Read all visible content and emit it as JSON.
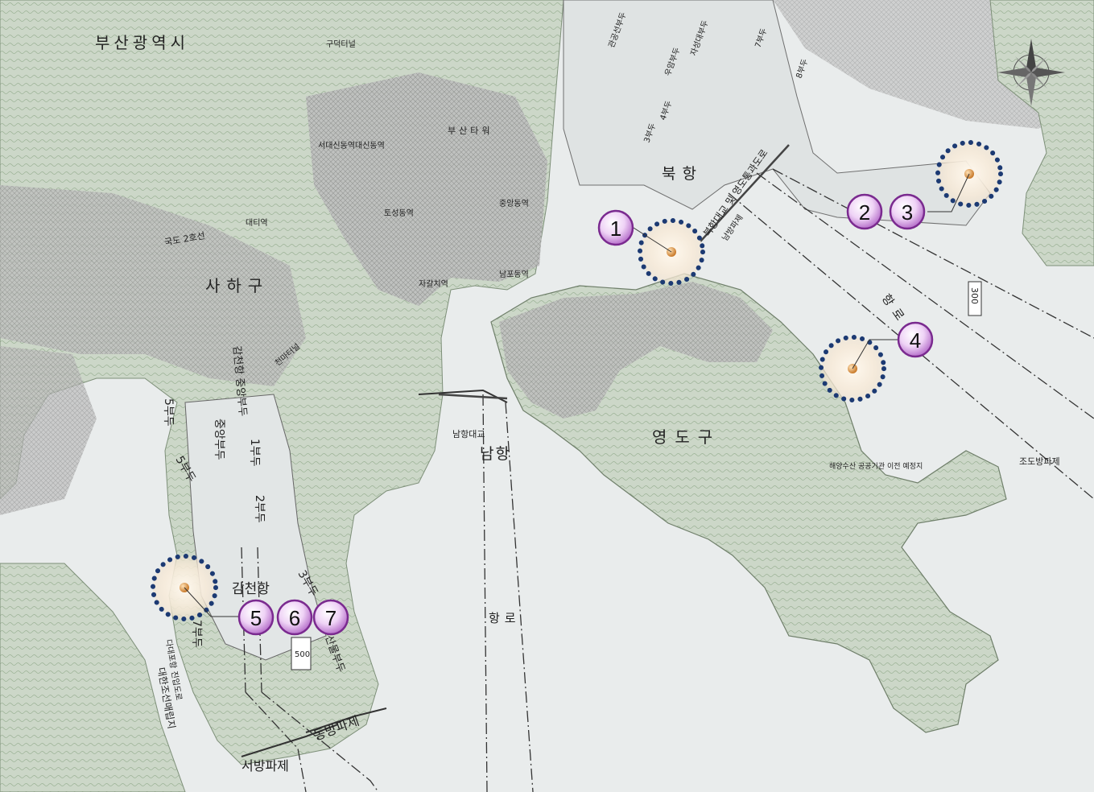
{
  "colors": {
    "sea": "#e9ecec",
    "land": "#c9d4c6",
    "land_dark": "#9fb19a",
    "city": "#a9a9a9",
    "marker_ring": "#1c3a73",
    "badge_fill": "#c98ad8",
    "badge_stroke": "#7a2a8f"
  },
  "labels": {
    "busan_city": "부산광역시",
    "saha_gu": "사하구",
    "yeongdo_gu": "영도구",
    "bukhang": "북항",
    "namhang": "남항",
    "gamcheon_port": "감천항",
    "north_route": "항로",
    "south_route": "항로",
    "namhang_bridge": "남항대교",
    "bukhang_bridge": "북항대교 및 영도통과도로",
    "namhang_breakwater": "남방파제",
    "west_breakwater": "서방파제",
    "east_breakwater": "동방파제",
    "jodo_breakwater": "조도방파제",
    "guduk_tunnel": "구덕터널",
    "busan_station": "부산타워",
    "seodaeshin": "서대신동역대신동역",
    "toseong": "토성동역",
    "jungang": "중앙동역",
    "jagalchi": "자갈치역",
    "nampo": "남포동역",
    "daeti": "대티역",
    "national_road": "국도 2호선",
    "chunma_tunnel": "천마터널",
    "ocean_agency": "해양수산 공공기관 이전 예정지",
    "central_pier": "중앙부두",
    "pier_1": "1부두",
    "pier_2": "2부두",
    "pier_3": "3부두",
    "pier_5": "5부두",
    "pier_6": "6부두",
    "pier_7": "7부두",
    "pier_7_north": "7부두",
    "pier_4_bukhang": "4부두",
    "pier_3_bukhang": "3부두",
    "pier_8_bukhang": "8부두",
    "gamcheon_pier": "감천항 중앙부두",
    "fishery_pier": "수산물부두",
    "daehan_shipyard": "대한조선매립지",
    "dadaepo_road": "다대포항 진입도로",
    "gwanggong": "관공선부두",
    "jaseongdae": "자성대부두",
    "ugam": "우암부두",
    "depth_300": "300",
    "depth_500": "500"
  },
  "markers": [
    {
      "id": "1",
      "label": "1"
    },
    {
      "id": "2",
      "label": "2"
    },
    {
      "id": "3",
      "label": "3"
    },
    {
      "id": "4",
      "label": "4"
    },
    {
      "id": "5",
      "label": "5"
    },
    {
      "id": "6",
      "label": "6"
    },
    {
      "id": "7",
      "label": "7"
    }
  ],
  "compass_icon": "compass-rose-icon"
}
